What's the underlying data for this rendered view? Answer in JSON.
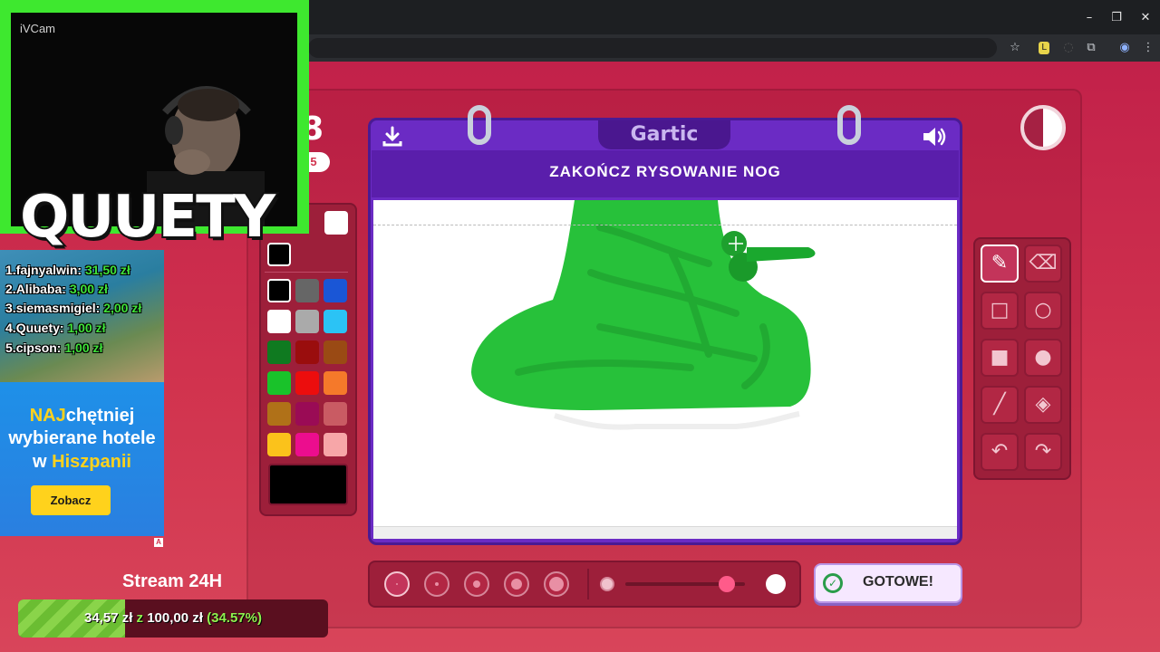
{
  "browser": {
    "window_buttons": [
      "–",
      "❐",
      "✕"
    ],
    "toolbar_icons": [
      "star-icon",
      "extension-icon",
      "puzzle-icon",
      "profile-icon",
      "menu-icon"
    ]
  },
  "overlay": {
    "webcam_label": "iVCam",
    "streamer_name": "QUUETY",
    "donations": [
      {
        "rank": "1.",
        "name": "fajnyalwin:",
        "amount": "31,50 zł"
      },
      {
        "rank": "2.",
        "name": "Alibaba:",
        "amount": "3,00 zł"
      },
      {
        "rank": "3.",
        "name": "siemasmigiel:",
        "amount": "2,00 zł"
      },
      {
        "rank": "4.",
        "name": "Quuety:",
        "amount": "1,00 zł"
      },
      {
        "rank": "5.",
        "name": "cipson:",
        "amount": "1,00 zł"
      }
    ],
    "ad": {
      "line1_highlight": "NAJ",
      "line1_rest": "chętniej",
      "line2": "wybierane hotele",
      "line3_prefix": "w ",
      "line3_highlight": "Hiszpanii",
      "button": "Zobacz",
      "badge": "A"
    },
    "stream_title": "Stream 24H",
    "goal": {
      "current": "34,57 zł",
      "separator": "z",
      "target": "100,00 zł",
      "percent_text": "(34.57%)",
      "progress": 0.3457
    }
  },
  "game": {
    "score_partial": "8",
    "round_partial": "5",
    "logo": "Gartic",
    "instruction": "ZAKOŃCZ RYSOWANIE NOG",
    "done_button": "GOTOWE!",
    "timer_remaining": 0.5,
    "palette": {
      "selected": "#000000",
      "colors": [
        "#000000",
        "#666666",
        "#1a56d6",
        "#ffffff",
        "#aaaaaa",
        "#2bc3f5",
        "#0f7a20",
        "#9a0d0d",
        "#9a4a14",
        "#19c22a",
        "#ec0d0d",
        "#f5792a",
        "#b07118",
        "#9a0b55",
        "#c95b63",
        "#fbc21b",
        "#ec0d8e",
        "#f7a6a8"
      ]
    },
    "tools": [
      "pencil-icon",
      "eraser-icon",
      "rectangle-outline-icon",
      "circle-outline-icon",
      "rectangle-filled-icon",
      "circle-filled-icon",
      "line-icon",
      "fill-bucket-icon",
      "undo-icon",
      "redo-icon"
    ],
    "active_tool": "pencil-icon",
    "brush_sizes": 5,
    "opacity_level": 0.85
  }
}
